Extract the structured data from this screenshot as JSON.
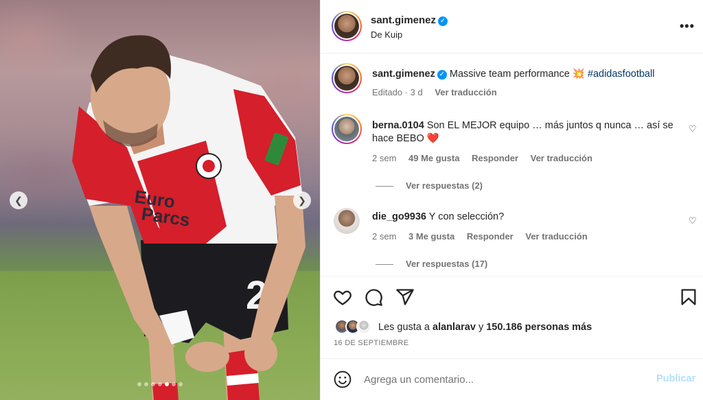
{
  "post": {
    "author": "sant.gimenez",
    "location": "De Kuip",
    "carousel": {
      "slide_count": 7,
      "active_index": 4
    },
    "jersey_print": [
      "Euro",
      "Parcs"
    ],
    "shirt_number": "2"
  },
  "caption": {
    "author": "sant.gimenez",
    "text": "Massive team performance",
    "emoji": "💥",
    "hashtag": "#adidasfootball",
    "edited": "Editado · 3 d",
    "translate": "Ver traducción"
  },
  "comments": [
    {
      "author": "berna.0104",
      "text": "Son EL MEJOR equipo … más juntos q nunca … así se hace BEBO",
      "emoji": "❤️",
      "age": "2 sem",
      "likes": "49 Me gusta",
      "reply": "Responder",
      "translate": "Ver traducción",
      "view_replies": "Ver respuestas (2)"
    },
    {
      "author": "die_go9936",
      "text": "Y con selección?",
      "age": "2 sem",
      "likes": "3 Me gusta",
      "reply": "Responder",
      "translate": "Ver traducción",
      "view_replies": "Ver respuestas (17)"
    }
  ],
  "actions": {
    "icons": [
      "heart-icon",
      "comment-icon",
      "share-icon",
      "bookmark-icon"
    ]
  },
  "likes": {
    "prefix": "Les gusta a",
    "user": "alanlarav",
    "connector": "y",
    "others": "150.186 personas más"
  },
  "date": "16 DE SEPTIEMBRE",
  "composer": {
    "placeholder": "Agrega un comentario...",
    "publish": "Publicar"
  },
  "colors": {
    "link": "#00376b",
    "verified": "#0095f6",
    "publish_disabled": "#b2dffc",
    "like_heart": "#ed4956"
  }
}
